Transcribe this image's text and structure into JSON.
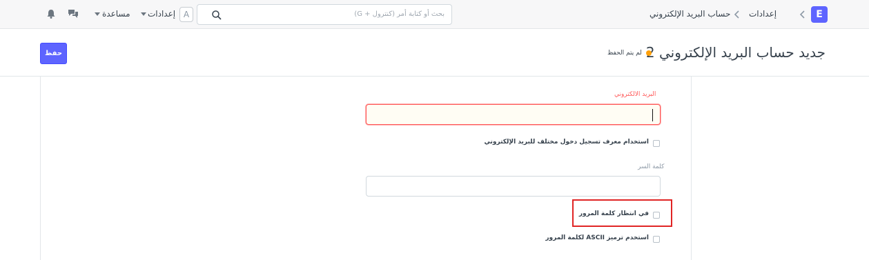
{
  "navbar": {
    "brand_letter": "E",
    "breadcrumbs": [
      "إعدادات",
      "حساب البريد الإلكتروني"
    ],
    "search_placeholder": "بحث أو كتابة أمر (كنترول + G)",
    "avatar_letter": "A",
    "settings_label": "إعدادات",
    "help_label": "مساعدة"
  },
  "page_head": {
    "title": "جديد حساب البريد الإلكتروني 2",
    "status_indicator_color": "#ffa00a",
    "status_text": "لم يتم الحفظ",
    "save_label": "حفظ"
  },
  "form": {
    "email": {
      "label": "البريد الالكتروني",
      "value": ""
    },
    "use_different_login": {
      "label": "استخدام معرف تسجيل دخول مختلف للبريد الإلكتروني",
      "checked": false
    },
    "password": {
      "label": "كلمة السر",
      "value": ""
    },
    "awaiting_password": {
      "label": "في انتظار كلمة المرور",
      "checked": false
    },
    "ascii_password": {
      "label": "استخدم ترميز ASCII لكلمة المرور",
      "checked": false
    }
  },
  "colors": {
    "accent": "#5e64ff",
    "error": "#ff5858",
    "highlight": "#e02424"
  }
}
